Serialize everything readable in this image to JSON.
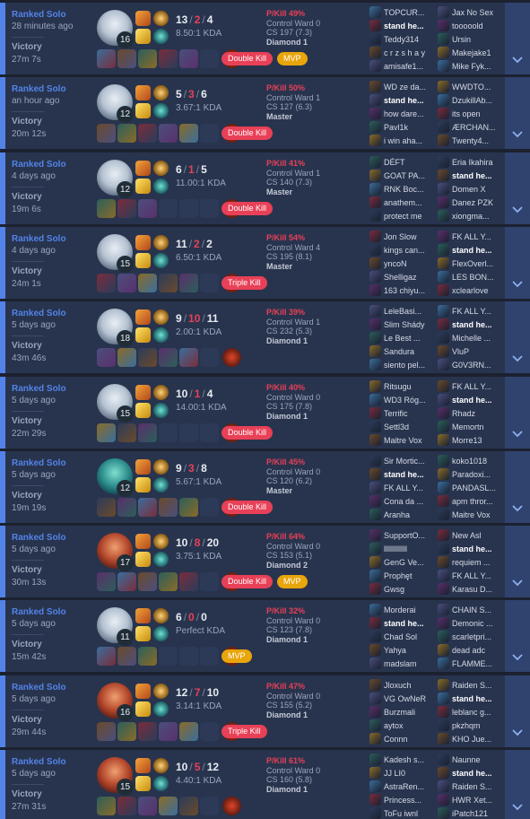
{
  "colors": {
    "accent": "#5383e8",
    "death": "#e84057",
    "badge_kill": "#e84057",
    "badge_mvp": "#e9a50c"
  },
  "expand_icon": "chevron-down-icon",
  "matches": [
    {
      "queue": "Ranked Solo",
      "time_ago": "28 minutes ago",
      "result": "Victory",
      "length": "27m 7s",
      "champion_icon": "white-haired-champion-portrait",
      "level": "16",
      "kills": "13",
      "deaths": "2",
      "assists": "4",
      "kda": "8.50:1 KDA",
      "pkill": "P/Kill 49%",
      "control_ward": "Control Ward 0",
      "cs": "CS 197 (7.3)",
      "rank": "Diamond 1",
      "badges": [
        {
          "label": "Double Kill",
          "type": "red"
        },
        {
          "label": "MVP",
          "type": "mvp"
        }
      ],
      "team_blue": [
        "TOPCUR...",
        "stand he...",
        "Teddy314",
        "c r z s h a y",
        "amisafe1..."
      ],
      "team_red": [
        "Jax No Sex",
        "tooooold",
        "Ursin",
        "Makejake1",
        "Mike Fyk..."
      ],
      "me_index": 1,
      "me_team": "blue"
    },
    {
      "queue": "Ranked Solo",
      "time_ago": "an hour ago",
      "result": "Victory",
      "length": "20m 12s",
      "champion_icon": "white-haired-champion-portrait",
      "level": "12",
      "kills": "5",
      "deaths": "3",
      "assists": "6",
      "kda": "3.67:1 KDA",
      "pkill": "P/Kill 50%",
      "control_ward": "Control Ward 1",
      "cs": "CS 127 (6.3)",
      "rank": "Master",
      "badges": [
        {
          "label": "Double Kill",
          "type": "red"
        }
      ],
      "team_blue": [
        "WD ze da...",
        "stand he...",
        "how dare...",
        "Pavl1k",
        "i win aha..."
      ],
      "team_red": [
        "WWDTO...",
        "DzukillAb...",
        "its open",
        "ÆRCHAN...",
        "Twenty4..."
      ],
      "me_index": 1,
      "me_team": "blue"
    },
    {
      "queue": "Ranked Solo",
      "time_ago": "4 days ago",
      "result": "Victory",
      "length": "19m 6s",
      "champion_icon": "white-haired-champion-portrait",
      "level": "12",
      "kills": "6",
      "deaths": "1",
      "assists": "5",
      "kda": "11.00:1 KDA",
      "pkill": "P/Kill 41%",
      "control_ward": "Control Ward 1",
      "cs": "CS 140 (7.3)",
      "rank": "Master",
      "badges": [
        {
          "label": "Double Kill",
          "type": "red"
        }
      ],
      "team_blue": [
        "DÉFT",
        "GOAT PA...",
        "RNK Boc...",
        "anathem...",
        "protect me"
      ],
      "team_red": [
        "Eria Ikahira",
        "stand he...",
        "Domen X",
        "Danez PZK",
        "xiongma..."
      ],
      "me_index": 1,
      "me_team": "red"
    },
    {
      "queue": "Ranked Solo",
      "time_ago": "4 days ago",
      "result": "Victory",
      "length": "24m 1s",
      "champion_icon": "white-haired-champion-portrait",
      "level": "15",
      "kills": "11",
      "deaths": "2",
      "assists": "2",
      "kda": "6.50:1 KDA",
      "pkill": "P/Kill 54%",
      "control_ward": "Control Ward 4",
      "cs": "CS 195 (8.1)",
      "rank": "Master",
      "badges": [
        {
          "label": "Triple Kill",
          "type": "red"
        }
      ],
      "team_blue": [
        "Jon Slow",
        "kings can...",
        "yncoN",
        "Shelligaz",
        "163 chiyu..."
      ],
      "team_red": [
        "FK ALL Y...",
        "stand he...",
        "FlexOverl...",
        "LES BON...",
        "xclearlove"
      ],
      "me_index": 1,
      "me_team": "red"
    },
    {
      "queue": "Ranked Solo",
      "time_ago": "5 days ago",
      "result": "Victory",
      "length": "43m 46s",
      "champion_icon": "white-haired-champion-portrait",
      "level": "18",
      "kills": "9",
      "deaths": "10",
      "assists": "11",
      "kda": "2.00:1 KDA",
      "pkill": "P/Kill 39%",
      "control_ward": "Control Ward 1",
      "cs": "CS 232 (5.3)",
      "rank": "Diamond 1",
      "badges": [],
      "team_blue": [
        "LeleBasi...",
        "Slim Shády",
        "Le Best ...",
        "Sandura",
        "siento pel..."
      ],
      "team_red": [
        "FK ALL Y...",
        "stand he...",
        "Michelle ...",
        "VluP",
        "G0V3RN..."
      ],
      "me_index": 1,
      "me_team": "red"
    },
    {
      "queue": "Ranked Solo",
      "time_ago": "5 days ago",
      "result": "Victory",
      "length": "22m 29s",
      "champion_icon": "white-haired-champion-portrait",
      "level": "15",
      "kills": "10",
      "deaths": "1",
      "assists": "4",
      "kda": "14.00:1 KDA",
      "pkill": "P/Kill 40%",
      "control_ward": "Control Ward 0",
      "cs": "CS 175 (7.8)",
      "rank": "Diamond 1",
      "badges": [
        {
          "label": "Double Kill",
          "type": "red"
        }
      ],
      "team_blue": [
        "Ritsugu",
        "WD3 Róg...",
        "Terrific",
        "Settl3d",
        "Maitre Vox"
      ],
      "team_red": [
        "FK ALL Y...",
        "stand he...",
        "Rhadz",
        "Memortn",
        "Morre13"
      ],
      "me_index": 1,
      "me_team": "red"
    },
    {
      "queue": "Ranked Solo",
      "time_ago": "5 days ago",
      "result": "Victory",
      "length": "19m 19s",
      "champion_icon": "teal-champion-portrait",
      "level": "12",
      "kills": "9",
      "deaths": "3",
      "assists": "8",
      "kda": "5.67:1 KDA",
      "pkill": "P/Kill 45%",
      "control_ward": "Control Ward 0",
      "cs": "CS 120 (6.2)",
      "rank": "Master",
      "badges": [
        {
          "label": "Double Kill",
          "type": "red"
        }
      ],
      "team_blue": [
        "Sir Mortic...",
        "stand he...",
        "FK ALL Y...",
        "Cona da ...",
        "Aranha"
      ],
      "team_red": [
        "koko1018",
        "Paradoxi...",
        "PANDASL...",
        "apm thror...",
        "Maitre Vox"
      ],
      "me_index": 1,
      "me_team": "blue"
    },
    {
      "queue": "Ranked Solo",
      "time_ago": "5 days ago",
      "result": "Victory",
      "length": "30m 13s",
      "champion_icon": "red-champion-portrait",
      "level": "17",
      "kills": "10",
      "deaths": "8",
      "assists": "20",
      "kda": "3.75:1 KDA",
      "pkill": "P/Kill 64%",
      "control_ward": "Control Ward 0",
      "cs": "CS 153 (5.1)",
      "rank": "Diamond 2",
      "badges": [
        {
          "label": "Double Kill",
          "type": "red"
        },
        {
          "label": "MVP",
          "type": "mvp"
        }
      ],
      "team_blue": [
        "SupportO...",
        "lllllllllllll",
        "GenG Ve...",
        "Prophęt",
        "Gwsg"
      ],
      "team_red": [
        "New Asl",
        "stand he...",
        "requiem ...",
        "FK ALL Y...",
        "Karasu D..."
      ],
      "me_index": 1,
      "me_team": "red"
    },
    {
      "queue": "Ranked Solo",
      "time_ago": "5 days ago",
      "result": "Victory",
      "length": "15m 42s",
      "champion_icon": "white-haired-champion-portrait",
      "level": "11",
      "kills": "6",
      "deaths": "0",
      "assists": "0",
      "kda": "Perfect KDA",
      "pkill": "P/Kill 32%",
      "control_ward": "Control Ward 0",
      "cs": "CS 123 (7.8)",
      "rank": "Diamond 1",
      "badges": [
        {
          "label": "MVP",
          "type": "mvp"
        }
      ],
      "team_blue": [
        "Morderai",
        "stand he...",
        "Chad Sol",
        "Yahya",
        "madslam"
      ],
      "team_red": [
        "CHAIN S...",
        "Demonic ...",
        "scarletpri...",
        "dead adc",
        "FLAMME..."
      ],
      "me_index": 1,
      "me_team": "blue"
    },
    {
      "queue": "Ranked Solo",
      "time_ago": "5 days ago",
      "result": "Victory",
      "length": "29m 44s",
      "champion_icon": "red-champion-portrait",
      "level": "16",
      "kills": "12",
      "deaths": "7",
      "assists": "10",
      "kda": "3.14:1 KDA",
      "pkill": "P/Kill 47%",
      "control_ward": "Control Ward 0",
      "cs": "CS 155 (5.2)",
      "rank": "Diamond 1",
      "badges": [
        {
          "label": "Triple Kill",
          "type": "red"
        }
      ],
      "team_blue": [
        "Jloxuch",
        "VG OwNeR",
        "Burzmali",
        "aytox",
        "Connn"
      ],
      "team_red": [
        "Raiden S...",
        "stand he...",
        "leblanc g...",
        "pkzhqm",
        "KHO Jue..."
      ],
      "me_index": 1,
      "me_team": "red"
    },
    {
      "queue": "Ranked Solo",
      "time_ago": "5 days ago",
      "result": "Victory",
      "length": "27m 31s",
      "champion_icon": "red-champion-portrait",
      "level": "15",
      "kills": "10",
      "deaths": "5",
      "assists": "12",
      "kda": "4.40:1 KDA",
      "pkill": "P/Kill 61%",
      "control_ward": "Control Ward 0",
      "cs": "CS 160 (5.8)",
      "rank": "Diamond 1",
      "badges": [],
      "team_blue": [
        "Kadesh s...",
        "JJ LI0",
        "AstraRen...",
        "Princess...",
        "ToFu iwnl"
      ],
      "team_red": [
        "Naunne",
        "stand he...",
        "Raiden S...",
        "HWR Xet...",
        "iPatch121"
      ],
      "me_index": 1,
      "me_team": "red"
    }
  ]
}
